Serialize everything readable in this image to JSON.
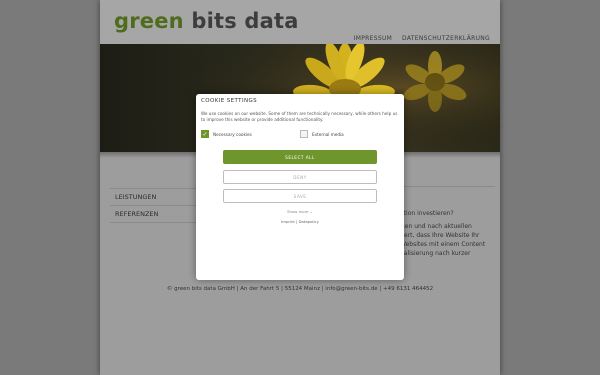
{
  "header": {
    "logo_green": "green",
    "logo_rest": "bits data",
    "nav": [
      "IMPRESSUM",
      "DATENSCHUTZERKLÄRUNG"
    ]
  },
  "sidenav": [
    "LEISTUNGEN",
    "REFERENZEN"
  ],
  "content_lines": [
    "ation investieren?",
    "",
    "isen und nach aktuellen",
    "tiert, dass Ihre Website Ihr",
    "Websites mit einem Content",
    "ualisierung nach kurzer"
  ],
  "footer": "© green bits data GmbH | An der Fahrt 5 | 55124 Mainz | info@green-bits.de | +49 6131 464452",
  "cookie": {
    "title": "COOKIE SETTINGS",
    "text": "We use cookies on our website. Some of them are technically necessary, while others help us to improve this website or provide additional functionality.",
    "options": [
      "Necessary cookies",
      "External media"
    ],
    "select_all": "SELECT ALL",
    "deny": "DENY",
    "save": "SAVE",
    "more": "Show more",
    "links": "Imprint | Datapolicy"
  },
  "colors": {
    "accent": "#6f962c",
    "logo_green": "#4f6b1d"
  }
}
